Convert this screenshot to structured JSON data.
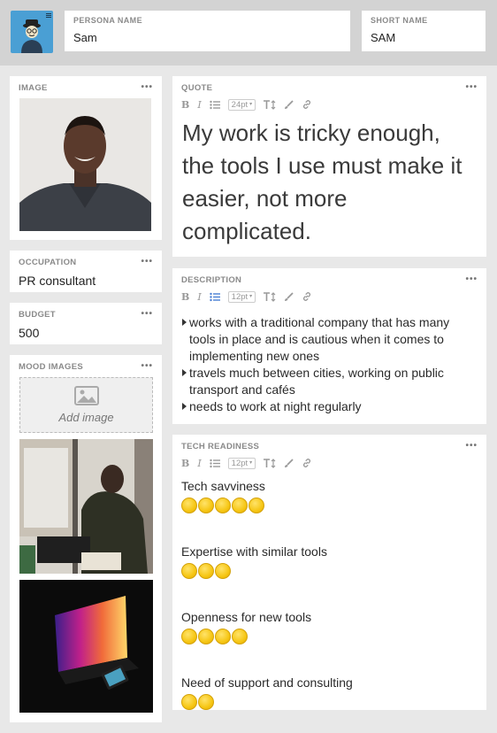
{
  "header": {
    "persona_label": "PERSONA NAME",
    "persona_value": "Sam",
    "short_label": "SHORT NAME",
    "short_value": "SAM"
  },
  "image_card": {
    "title": "IMAGE",
    "menu": "•••"
  },
  "occupation": {
    "title": "OCCUPATION",
    "menu": "•••",
    "value": "PR consultant"
  },
  "budget": {
    "title": "BUDGET",
    "menu": "•••",
    "value": "500"
  },
  "mood": {
    "title": "MOOD IMAGES",
    "menu": "•••",
    "add_label": "Add image"
  },
  "quote": {
    "title": "QUOTE",
    "menu": "•••",
    "font_size": "24pt",
    "text": "My work is tricky enough, the tools I use must make it easier, not more complicated."
  },
  "description": {
    "title": "DESCRIPTION",
    "menu": "•••",
    "font_size": "12pt",
    "items": [
      "works with a traditional company that has many tools in place and is cautious when it comes to implementing new ones",
      "travels much between cities, working on public transport and cafés",
      "needs to work at night regularly"
    ]
  },
  "tech": {
    "title": "TECH READINESS",
    "menu": "•••",
    "font_size": "12pt",
    "items": [
      {
        "label": "Tech savviness",
        "rating": 5
      },
      {
        "label": "Expertise with similar tools",
        "rating": 3
      },
      {
        "label": "Openness for new tools",
        "rating": 4
      },
      {
        "label": "Need of support and consulting",
        "rating": 2
      }
    ]
  },
  "toolbar": {
    "bold": "B",
    "italic": "I",
    "caret": "▾"
  },
  "colors": {
    "accent": "#4a9fd4",
    "topbar": "#d3d3d3",
    "background": "#e8e8e8",
    "rating": "#f6c614"
  }
}
